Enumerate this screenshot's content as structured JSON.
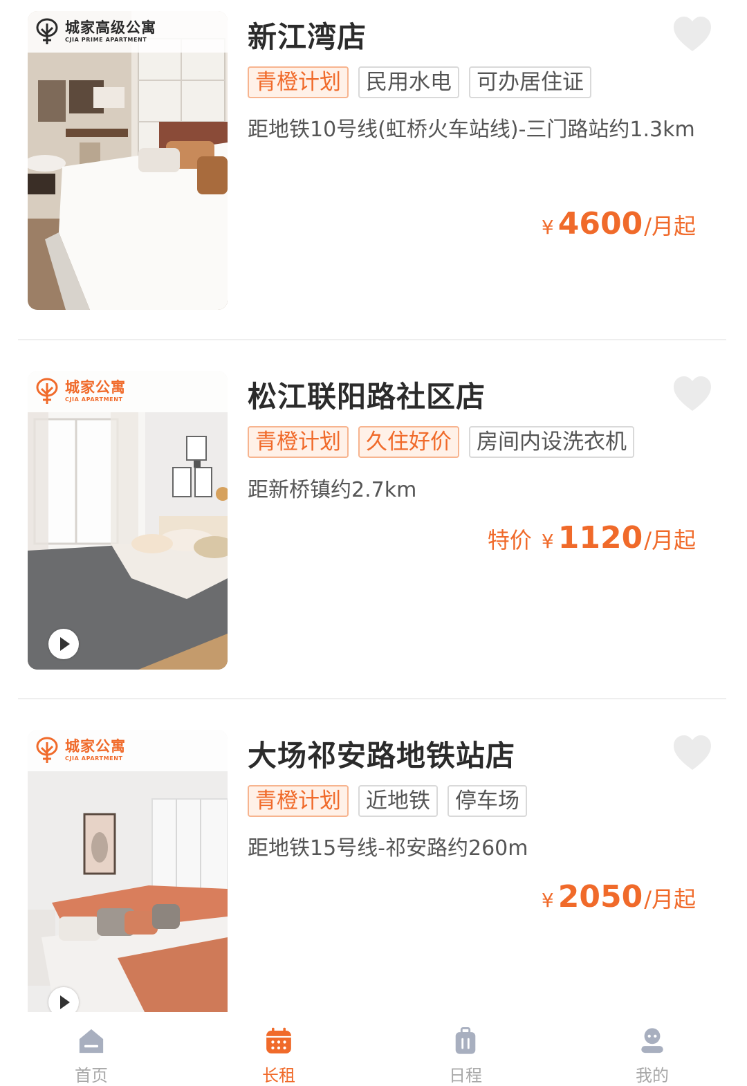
{
  "colors": {
    "accent": "#f06a2a",
    "tag_border": "#d9d9d9",
    "tab_inactive": "#a8a8a8"
  },
  "listings": [
    {
      "brand": {
        "cn": "城家高级公寓",
        "en": "CJIA PRIME APARTMENT",
        "style": "dark"
      },
      "title": "新江湾店",
      "tags": [
        {
          "label": "青橙计划",
          "style": "orange"
        },
        {
          "label": "民用水电",
          "style": "gray"
        },
        {
          "label": "可办居住证",
          "style": "gray"
        }
      ],
      "distance": "距地铁10号线(虹桥火车站线)-三门路站约1.3km",
      "price": {
        "prefix": "",
        "currency": "¥",
        "amount": "4600",
        "unit": "/月起"
      },
      "favorite_icon": "heart-icon",
      "has_video": false
    },
    {
      "brand": {
        "cn": "城家公寓",
        "en": "CJIA APARTMENT",
        "style": "orange"
      },
      "title": "松江联阳路社区店",
      "tags": [
        {
          "label": "青橙计划",
          "style": "orange"
        },
        {
          "label": "久住好价",
          "style": "orange"
        },
        {
          "label": "房间内设洗衣机",
          "style": "gray"
        }
      ],
      "distance": "距新桥镇约2.7km",
      "price": {
        "prefix": "特价",
        "currency": "¥",
        "amount": "1120",
        "unit": "/月起"
      },
      "favorite_icon": "heart-icon",
      "has_video": true
    },
    {
      "brand": {
        "cn": "城家公寓",
        "en": "CJIA APARTMENT",
        "style": "orange"
      },
      "title": "大场祁安路地铁站店",
      "tags": [
        {
          "label": "青橙计划",
          "style": "orange"
        },
        {
          "label": "近地铁",
          "style": "gray"
        },
        {
          "label": "停车场",
          "style": "gray"
        }
      ],
      "distance": "距地铁15号线-祁安路约260m",
      "price": {
        "prefix": "",
        "currency": "¥",
        "amount": "2050",
        "unit": "/月起"
      },
      "favorite_icon": "heart-icon",
      "has_video": true
    }
  ],
  "tabbar": {
    "active_index": 1,
    "items": [
      {
        "label": "首页",
        "icon": "home-icon"
      },
      {
        "label": "长租",
        "icon": "calendar-icon"
      },
      {
        "label": "日程",
        "icon": "luggage-icon"
      },
      {
        "label": "我的",
        "icon": "profile-icon"
      }
    ]
  }
}
